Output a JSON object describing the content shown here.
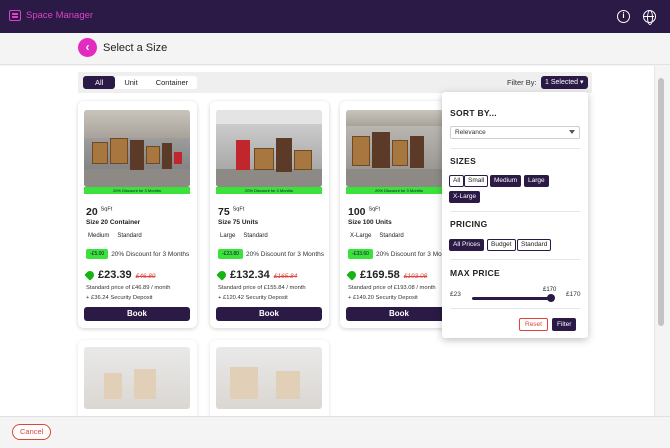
{
  "app": {
    "brand": "Space Manager"
  },
  "header": {
    "title": "Select a Size"
  },
  "tabs": [
    {
      "label": "All",
      "active": true
    },
    {
      "label": "Unit",
      "active": false
    },
    {
      "label": "Container",
      "active": false
    }
  ],
  "filter": {
    "label": "Filter By:",
    "selected": "1 Selected ▾"
  },
  "cards": [
    {
      "banner": "20% Discount for 3 Months",
      "sqft": "20",
      "sqft_unit": "SqFt",
      "name": "Size 20 Container",
      "tags": [
        "Medium",
        "Standard"
      ],
      "discount_badge": "-£5.00",
      "discount_text": "20% Discount for 3 Months",
      "price": "£23.39",
      "old_price": "£46.89",
      "standard_price": "Standard price of £46.89 / month",
      "deposit": "+ £36.24 Security Deposit",
      "book": "Book"
    },
    {
      "banner": "20% Discount for 3 Months",
      "sqft": "75",
      "sqft_unit": "SqFt",
      "name": "Size 75 Units",
      "tags": [
        "Large",
        "Standard"
      ],
      "discount_badge": "-£23.80",
      "discount_text": "20% Discount for 3 Months",
      "price": "£132.34",
      "old_price": "£165.84",
      "standard_price": "Standard price of £155.84 / month",
      "deposit": "+ £120.42 Security Deposit",
      "book": "Book"
    },
    {
      "banner": "20% Discount for 3 Months",
      "sqft": "100",
      "sqft_unit": "SqFt",
      "name": "Size 100 Units",
      "tags": [
        "X-Large",
        "Standard"
      ],
      "discount_badge": "-£33.60",
      "discount_text": "20% Discount for 3 Months",
      "price": "£169.58",
      "old_price": "£193.08",
      "standard_price": "Standard price of £193.08 / month",
      "deposit": "+ £149.20 Security Deposit",
      "book": "Book"
    }
  ],
  "panel": {
    "sort_heading": "SORT BY...",
    "sort_value": "Relevance",
    "sizes_heading": "SIZES",
    "sizes": [
      {
        "label": "All",
        "on": false
      },
      {
        "label": "Small",
        "on": false
      },
      {
        "label": "Medium",
        "on": true
      },
      {
        "label": "Large",
        "on": true
      },
      {
        "label": "X-Large",
        "on": true
      }
    ],
    "pricing_heading": "PRICING",
    "pricing": [
      {
        "label": "All Prices",
        "on": true
      },
      {
        "label": "Budget",
        "on": false
      },
      {
        "label": "Standard",
        "on": false
      }
    ],
    "max_price_heading": "MAX PRICE",
    "min_label": "£23",
    "max_label": "£170",
    "current": "£170",
    "reset": "Reset",
    "apply": "Filter"
  },
  "footer": {
    "cancel": "Cancel"
  },
  "colors": {
    "primary": "#2a1a45",
    "accent": "#e42bbf",
    "discount": "#3ce23c",
    "danger": "#e0433a"
  }
}
